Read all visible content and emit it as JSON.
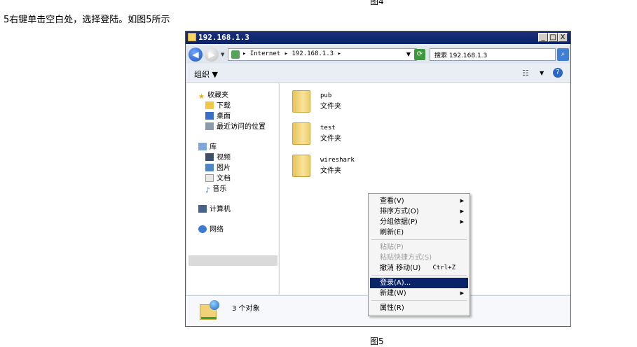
{
  "page": {
    "top_caption": "图4",
    "instruction": "5右键单击空白处，选择登陆。如图5所示",
    "bottom_caption": "图5"
  },
  "window": {
    "title": "192.168.1.3",
    "minimize": "_",
    "maximize": "□",
    "close": "X",
    "address_path": "▸ Internet ▸ 192.168.1.3 ▸",
    "address_dropdown": "▼",
    "search_placeholder": "搜索 192.168.1.3",
    "organize_label": "组织 ▼"
  },
  "nav": {
    "favorites_header": "收藏夹",
    "favorites": [
      "下载",
      "桌面",
      "最近访问的位置"
    ],
    "library_header": "库",
    "libraries": [
      "视频",
      "图片",
      "文档",
      "音乐"
    ],
    "computer": "计算机",
    "network": "网络"
  },
  "folders": [
    {
      "name": "pub",
      "type": "文件夹"
    },
    {
      "name": "test",
      "type": "文件夹"
    },
    {
      "name": "wireshark",
      "type": "文件夹"
    }
  ],
  "status": {
    "count_text": "3 个对象"
  },
  "context_menu": {
    "view": "查看(V)",
    "sort": "排序方式(O)",
    "group": "分组依据(P)",
    "refresh": "刷新(E)",
    "paste": "粘贴(P)",
    "paste_shortcut": "粘贴快捷方式(S)",
    "undo_move": "撤消 移动(U)",
    "undo_shortcut": "Ctrl+Z",
    "login": "登录(A)...",
    "new": "新建(W)",
    "properties": "属性(R)"
  },
  "colors": {
    "titlebar": "#0a246a",
    "highlight": "#0a246a",
    "folder": "#f3d77e"
  }
}
